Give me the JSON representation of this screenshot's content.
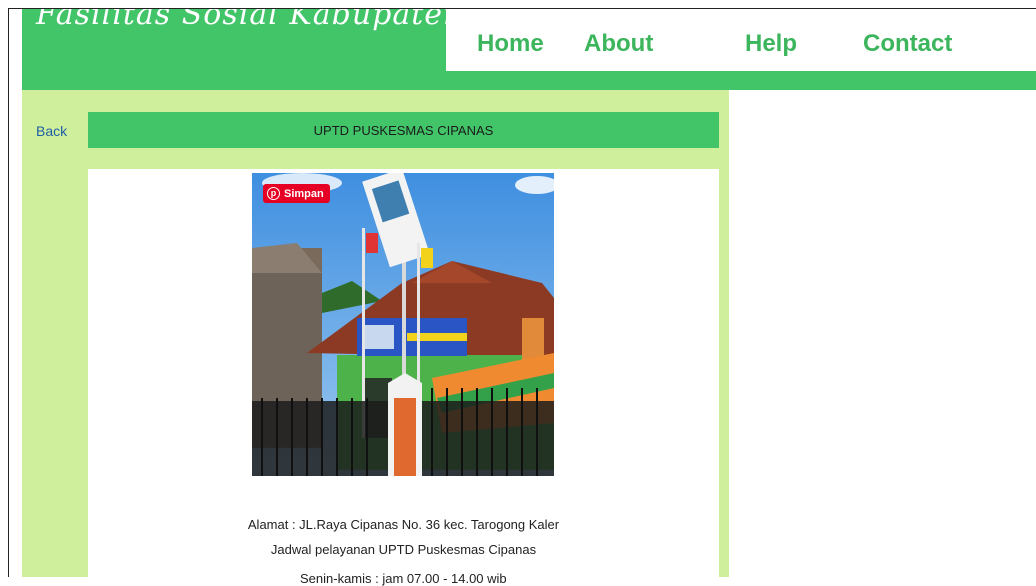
{
  "header": {
    "logo_text": "Fasilitas Sosial Kabupaten Garut"
  },
  "nav": {
    "items": [
      {
        "label": "Home"
      },
      {
        "label": "About"
      },
      {
        "label": "Help"
      },
      {
        "label": "Contact"
      }
    ]
  },
  "page": {
    "back_label": "Back",
    "title": "UPTD PUSKESMAS CIPANAS",
    "pin_label": "Simpan",
    "address": "Alamat : JL.Raya Cipanas No. 36 kec. Tarogong Kaler",
    "schedule_title": "Jadwal pelayanan UPTD Puskesmas Cipanas",
    "schedule_first_line": "Senin-kamis  :  jam 07.00 - 14.00 wib"
  },
  "colors": {
    "brand_green": "#42c468",
    "nav_green": "#3cb55c",
    "panel_green": "#d0ef9c",
    "link_blue": "#1f5fa6",
    "pinterest_red": "#e60023"
  }
}
